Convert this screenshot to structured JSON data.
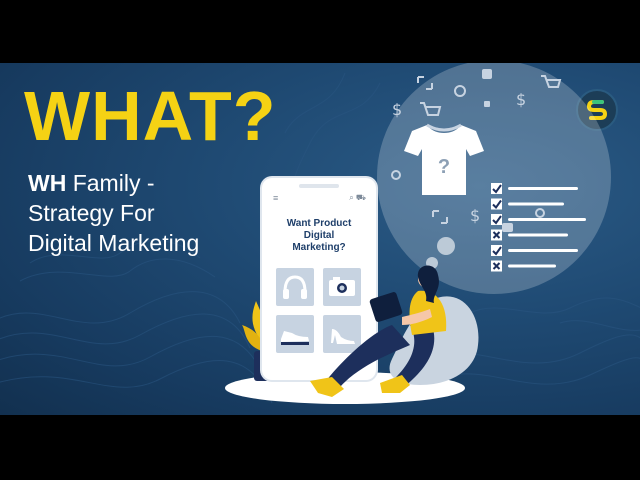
{
  "headline": "WHAT?",
  "subtitle": {
    "bold": "WH",
    "rest_line1": " Family -",
    "line2": "Strategy For",
    "line3": "Digital Marketing"
  },
  "phone": {
    "title_line1": "Want Product",
    "title_line2": "Digital",
    "title_line3": "Marketing?",
    "menu_icon": "≡",
    "header_icons": "⌕ ⛟"
  },
  "thought_bubble": {
    "product": "t-shirt",
    "product_mark": "?",
    "checklist": [
      "check",
      "check",
      "check",
      "cross",
      "check",
      "cross"
    ],
    "floating_icons": [
      "dollar",
      "cart",
      "gear",
      "shirt",
      "expand"
    ]
  },
  "colors": {
    "accent_yellow": "#f5d214",
    "background_blue": "#1f4a73",
    "navy": "#1d2f5c",
    "light_blue": "#c7d3e1",
    "white": "#ffffff"
  }
}
